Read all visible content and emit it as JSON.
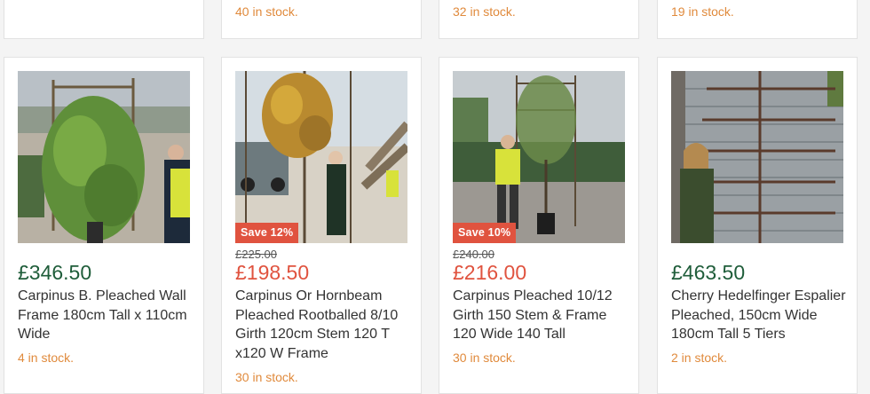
{
  "top_row": [
    {
      "stock": ""
    },
    {
      "stock": "40 in stock."
    },
    {
      "stock": "32 in stock."
    },
    {
      "stock": "19 in stock."
    }
  ],
  "products": [
    {
      "image_alt": "Pleached hornbeam wall frame held by staff member",
      "badge": "",
      "old_price": "",
      "price": "£346.50",
      "name": "Carpinus B. Pleached Wall Frame 180cm Tall x 110cm Wide",
      "stock": "4 in stock."
    },
    {
      "image_alt": "Pleached hornbeam rootballed tree with golden leaves",
      "badge": "Save 12%",
      "old_price": "£225.00",
      "price": "£198.50",
      "name": "Carpinus Or Hornbeam Pleached Rootballed 8/10 Girth 120cm Stem 120 T x120 W Frame",
      "stock": "30 in stock."
    },
    {
      "image_alt": "Pleached hornbeam tree in pot with worker in hi-vis",
      "badge": "Save 10%",
      "old_price": "£240.00",
      "price": "£216.00",
      "name": "Carpinus Pleached 10/12 Girth 150 Stem & Frame 120 Wide 140 Tall",
      "stock": "30 in stock."
    },
    {
      "image_alt": "Cherry espalier with five tiers against metal wall",
      "badge": "",
      "old_price": "",
      "price": "£463.50",
      "name": "Cherry Hedelfinger Espalier Pleached, 150cm Wide 180cm Tall 5 Tiers",
      "stock": "2 in stock."
    }
  ],
  "colors": {
    "price": "#1f5d3a",
    "sale_price": "#e0533f",
    "badge": "#e0533f",
    "stock": "#e08a3c"
  }
}
